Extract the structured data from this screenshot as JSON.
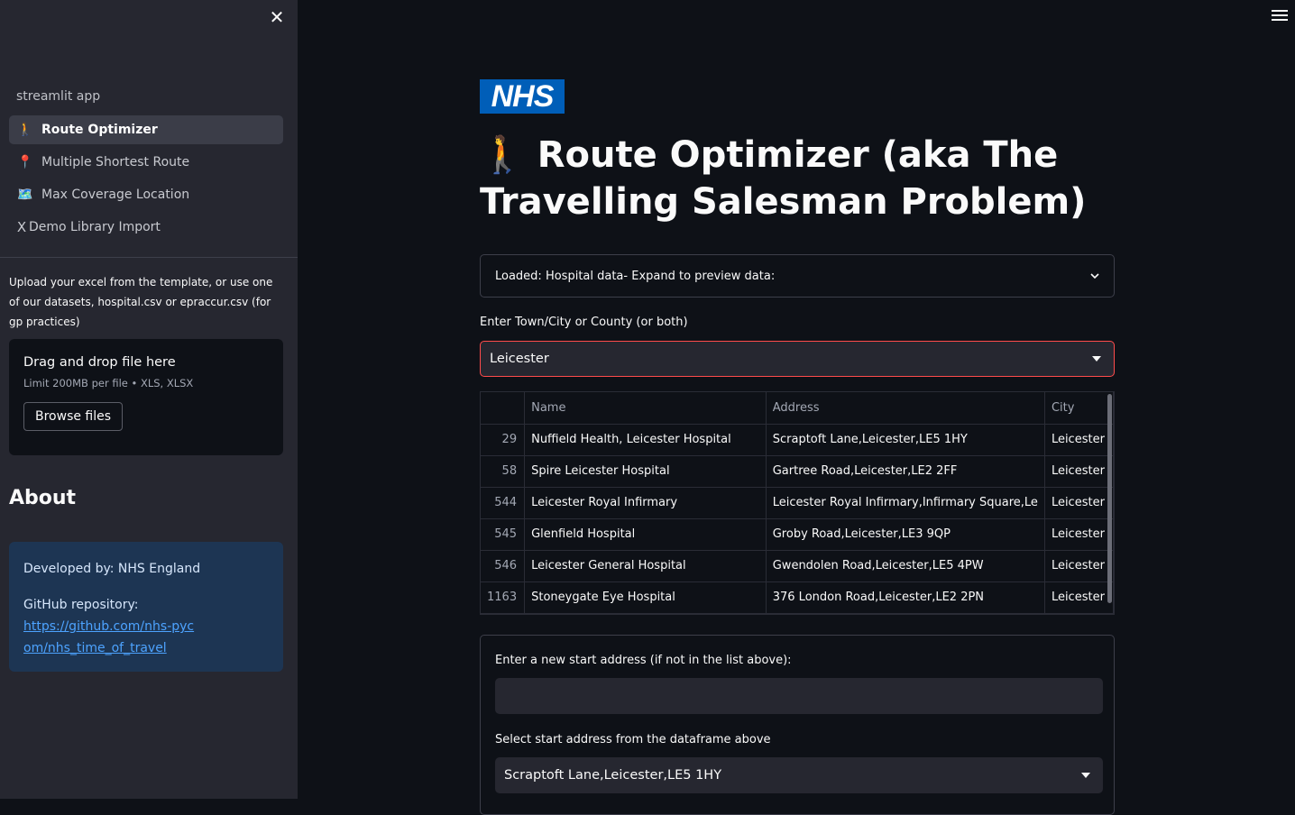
{
  "sidebar": {
    "close_glyph": "✕",
    "app_label": "streamlit app",
    "nav": [
      {
        "icon": "🚶",
        "icon_name": "walking-person-icon",
        "label": "Route Optimizer",
        "active": true
      },
      {
        "icon": "📍",
        "icon_name": "round-pushpin-icon",
        "label": "Multiple Shortest Route",
        "active": false
      },
      {
        "icon": "🗺️",
        "icon_name": "map-icon",
        "label": "Max Coverage Location",
        "active": false
      },
      {
        "icon": "X",
        "icon_name": "x-letter-icon",
        "label": "Demo Library Import",
        "active": false
      }
    ],
    "upload_text": "Upload your excel from the template, or use one of our datasets, hospital.csv or epraccur.csv (for gp practices)",
    "dropzone": {
      "title": "Drag and drop file here",
      "limit": "Limit 200MB per file • XLS, XLSX",
      "button": "Browse files"
    },
    "about_heading": "About",
    "info": {
      "developed_by": "Developed by: NHS England",
      "github_label": "GitHub repository:",
      "github_link": "https://github.com/nhs-pycom/nhs_time_of_travel"
    }
  },
  "main": {
    "logo_text": "NHS",
    "title_icon": "🚶",
    "title": "Route Optimizer (aka The Travelling Salesman Problem)",
    "expander_label": "Loaded: Hospital data- Expand to preview data:",
    "location_label": "Enter Town/City or County (or both)",
    "location_value": "Leicester",
    "table": {
      "columns": [
        "",
        "Name",
        "Address",
        "City"
      ],
      "rows": [
        {
          "idx": "29",
          "name": "Nuffield Health, Leicester Hospital",
          "address": "Scraptoft Lane,Leicester,LE5 1HY",
          "city": "Leicester"
        },
        {
          "idx": "58",
          "name": "Spire Leicester Hospital",
          "address": "Gartree Road,Leicester,LE2 2FF",
          "city": "Leicester"
        },
        {
          "idx": "544",
          "name": "Leicester Royal Infirmary",
          "address": "Leicester Royal Infirmary,Infirmary Square,Le",
          "city": "Leicester"
        },
        {
          "idx": "545",
          "name": "Glenfield Hospital",
          "address": "Groby Road,Leicester,LE3 9QP",
          "city": "Leicester"
        },
        {
          "idx": "546",
          "name": "Leicester General Hospital",
          "address": "Gwendolen Road,Leicester,LE5 4PW",
          "city": "Leicester"
        },
        {
          "idx": "1163",
          "name": "Stoneygate Eye Hospital",
          "address": "376 London Road,Leicester,LE2 2PN",
          "city": "Leicester"
        }
      ]
    },
    "start_address_label": "Enter a new start address (if not in the list above):",
    "start_address_value": "",
    "select_start_label": "Select start address from the dataframe above",
    "select_start_value": "Scraptoft Lane,Leicester,LE5 1HY"
  }
}
